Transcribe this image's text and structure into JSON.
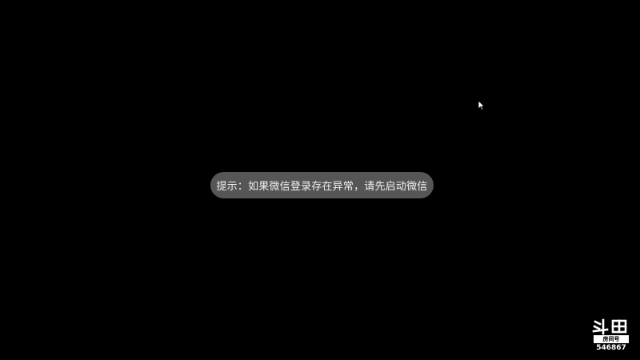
{
  "toast": {
    "message": "提示：如果微信登录存在异常，请先启动微信"
  },
  "watermark": {
    "logo": "斗鱼",
    "label": "房间号",
    "room_id": "546867"
  },
  "colors": {
    "background": "#000000",
    "toast_background": "#565656",
    "toast_text": "#f0f0f0"
  },
  "icons": {
    "cursor": "mouse-pointer-icon",
    "watermark": "douyu-logo-icon"
  }
}
